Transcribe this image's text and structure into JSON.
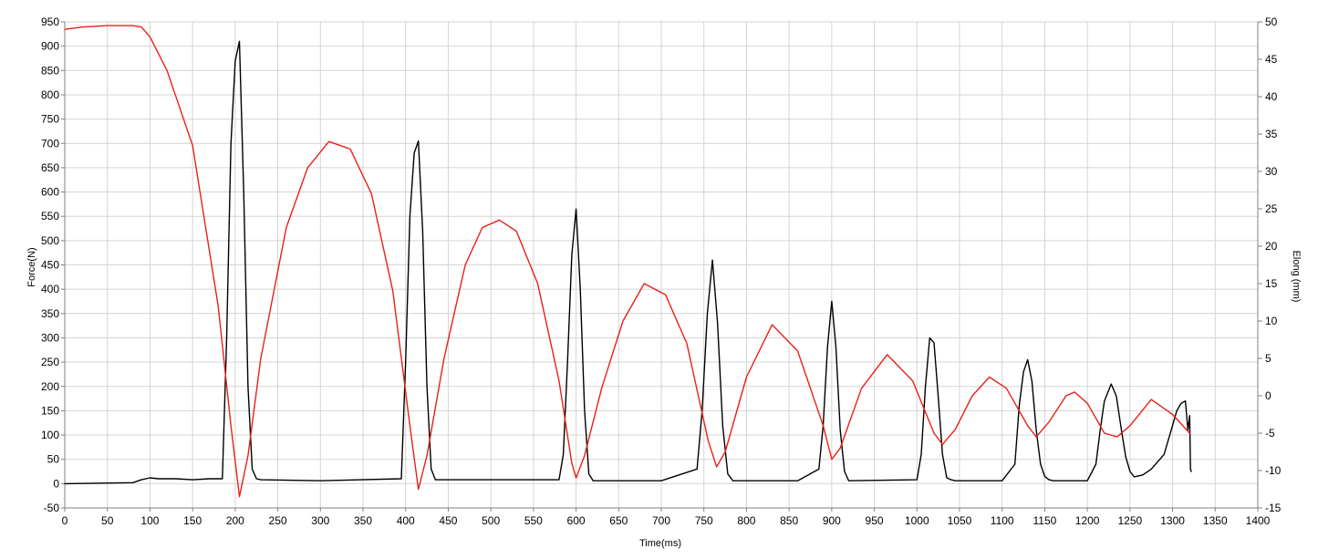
{
  "chart_data": {
    "type": "line",
    "title": "",
    "xlabel": "Time(ms)",
    "ylabel": "Force(N)",
    "y2label": "Elong (mm)",
    "xlim": [
      0,
      1400
    ],
    "ylim": [
      -50,
      950
    ],
    "y2lim": [
      -15,
      50
    ],
    "x_ticks": [
      0,
      50,
      100,
      150,
      200,
      250,
      300,
      350,
      400,
      450,
      500,
      550,
      600,
      650,
      700,
      750,
      800,
      850,
      900,
      950,
      1000,
      1050,
      1100,
      1150,
      1200,
      1250,
      1300,
      1350,
      1400
    ],
    "y_ticks": [
      -50,
      0,
      50,
      100,
      150,
      200,
      250,
      300,
      350,
      400,
      450,
      500,
      550,
      600,
      650,
      700,
      750,
      800,
      850,
      900,
      950
    ],
    "y2_ticks": [
      -15,
      -10,
      -5,
      0,
      5,
      10,
      15,
      20,
      25,
      30,
      35,
      40,
      45,
      50
    ],
    "grid": true,
    "colors": {
      "force": "#000000",
      "elong": "#e8201a",
      "grid": "#d4d4d4",
      "axis": "#808080"
    },
    "series": [
      {
        "axis": "left",
        "color": "#000000",
        "x": [
          0,
          80,
          90,
          100,
          110,
          130,
          150,
          170,
          185,
          190,
          195,
          200,
          205,
          210,
          215,
          220,
          225,
          230,
          300,
          395,
          400,
          405,
          410,
          415,
          420,
          425,
          430,
          435,
          500,
          580,
          585,
          590,
          595,
          600,
          605,
          610,
          615,
          620,
          700,
          742,
          748,
          754,
          760,
          766,
          772,
          778,
          784,
          860,
          885,
          890,
          895,
          900,
          905,
          910,
          915,
          920,
          1000,
          1005,
          1010,
          1015,
          1020,
          1025,
          1030,
          1035,
          1040,
          1045,
          1100,
          1115,
          1120,
          1125,
          1130,
          1135,
          1140,
          1145,
          1150,
          1155,
          1160,
          1170,
          1200,
          1210,
          1215,
          1220,
          1228,
          1234,
          1240,
          1245,
          1250,
          1255,
          1265,
          1275,
          1290,
          1300,
          1305,
          1310,
          1315,
          1318,
          1320,
          1321,
          1322
        ],
        "y": [
          0,
          2,
          8,
          12,
          10,
          10,
          8,
          10,
          10,
          300,
          700,
          870,
          910,
          600,
          200,
          30,
          10,
          8,
          6,
          10,
          250,
          550,
          680,
          705,
          520,
          200,
          30,
          8,
          8,
          8,
          60,
          250,
          470,
          565,
          400,
          150,
          20,
          6,
          6,
          30,
          150,
          350,
          460,
          330,
          120,
          20,
          6,
          6,
          30,
          120,
          280,
          375,
          280,
          110,
          25,
          6,
          8,
          60,
          200,
          300,
          290,
          180,
          60,
          12,
          8,
          6,
          6,
          40,
          160,
          230,
          255,
          210,
          110,
          40,
          15,
          8,
          6,
          6,
          6,
          40,
          110,
          170,
          205,
          180,
          110,
          55,
          25,
          14,
          18,
          30,
          60,
          120,
          150,
          165,
          170,
          110,
          140,
          30,
          25
        ]
      },
      {
        "axis": "right",
        "color": "#e8201a",
        "x": [
          0,
          20,
          50,
          80,
          90,
          100,
          120,
          150,
          180,
          195,
          205,
          215,
          230,
          260,
          285,
          310,
          335,
          360,
          385,
          405,
          415,
          425,
          445,
          470,
          490,
          510,
          530,
          555,
          580,
          595,
          600,
          610,
          630,
          655,
          680,
          705,
          730,
          755,
          765,
          775,
          800,
          830,
          860,
          890,
          900,
          910,
          935,
          965,
          995,
          1020,
          1030,
          1045,
          1065,
          1085,
          1105,
          1130,
          1140,
          1155,
          1175,
          1185,
          1200,
          1220,
          1235,
          1250,
          1275,
          1300,
          1320
        ],
        "y": [
          49,
          49.3,
          49.5,
          49.5,
          49.3,
          48,
          43.5,
          33.5,
          12,
          -4,
          -13.5,
          -8,
          5,
          22.5,
          30.5,
          34,
          33,
          27,
          14,
          -4,
          -12.5,
          -8,
          5,
          17.5,
          22.5,
          23.5,
          22,
          15,
          2,
          -9,
          -11,
          -8,
          1,
          10,
          15,
          13.5,
          7,
          -6,
          -9.5,
          -7.5,
          2.5,
          9.5,
          6,
          -4,
          -8.5,
          -7,
          1,
          5.5,
          2,
          -5,
          -6.5,
          -4.5,
          0,
          2.5,
          1,
          -4,
          -5.5,
          -3.5,
          0,
          0.5,
          -1,
          -5,
          -5.5,
          -4,
          -0.5,
          -2.5,
          -5
        ]
      }
    ]
  }
}
